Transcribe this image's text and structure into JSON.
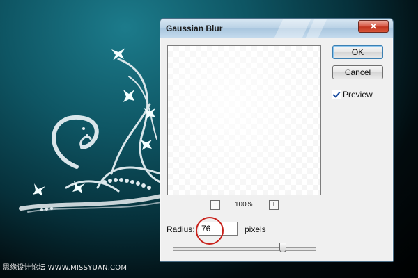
{
  "dialog": {
    "title": "Gaussian Blur",
    "close_icon": "close-x-icon",
    "close_glyph": "✕",
    "buttons": {
      "ok": "OK",
      "cancel": "Cancel"
    },
    "preview": {
      "label": "Preview",
      "checked": true
    },
    "zoom": {
      "minus": "−",
      "plus": "+",
      "level": "100%"
    },
    "radius": {
      "label": "Radius:",
      "value": "76",
      "units": "pixels"
    },
    "slider": {
      "fraction": 0.77
    }
  },
  "watermark": "思缘设计论坛 WWW.MISSYUAN.COM",
  "colors": {
    "title_bar": "#bcd3e6",
    "close_button": "#d9604e",
    "highlight_circle": "#c8211b",
    "background_teal": "#0e5563"
  }
}
